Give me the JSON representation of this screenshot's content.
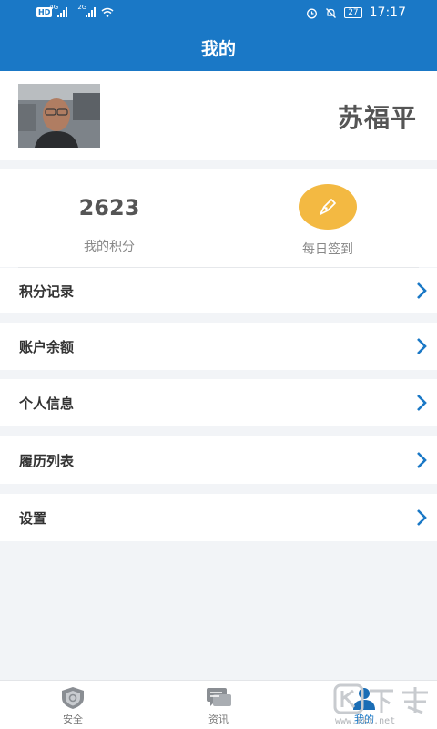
{
  "status_bar": {
    "network_badge": "HD",
    "signal_1_type": "4G",
    "signal_2_type": "2G",
    "battery": "27",
    "time": "17:17"
  },
  "header": {
    "title": "我的"
  },
  "profile": {
    "name": "苏福平",
    "avatar": "avatar-photo"
  },
  "stats": {
    "points_value": "2623",
    "points_label": "我的积分",
    "checkin_label": "每日签到",
    "checkin_icon": "pen-nib-icon"
  },
  "menu": [
    {
      "label": "积分记录"
    },
    {
      "label": "账户余额"
    },
    {
      "label": "个人信息"
    },
    {
      "label": "履历列表"
    },
    {
      "label": "设置"
    }
  ],
  "tab_bar": [
    {
      "label": "安全",
      "icon": "shield-icon",
      "active": false
    },
    {
      "label": "资讯",
      "icon": "chat-icon",
      "active": false
    },
    {
      "label": "我的",
      "icon": "person-icon",
      "active": true
    }
  ],
  "watermark": {
    "url": "www.kkx.net"
  },
  "colors": {
    "primary": "#1a78c6",
    "accent": "#f3b942",
    "background": "#f2f4f7"
  }
}
